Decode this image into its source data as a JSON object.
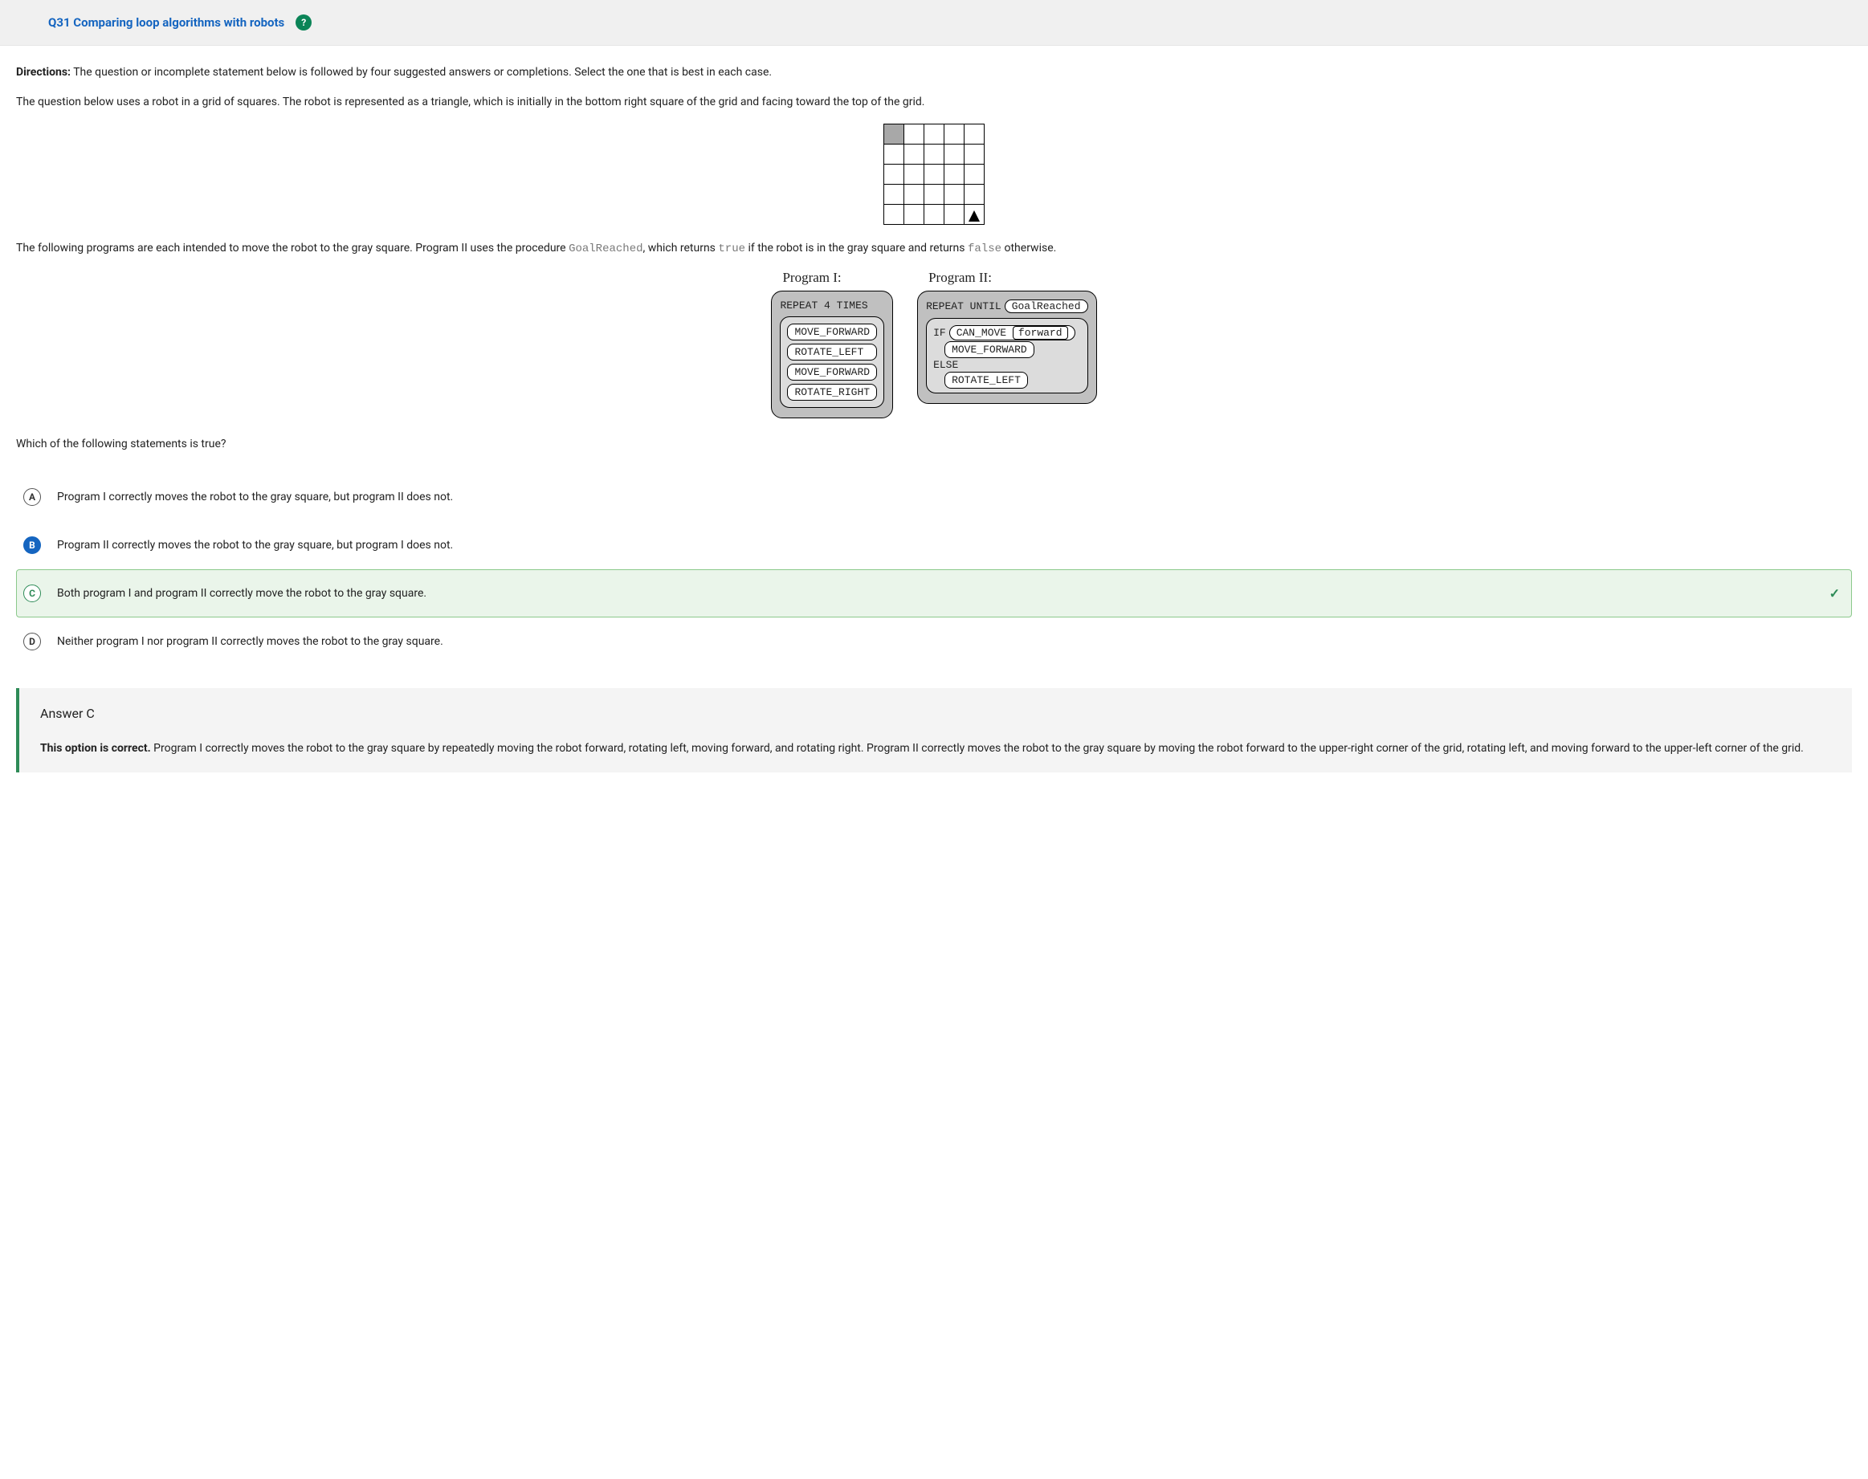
{
  "header": {
    "title": "Q31 Comparing loop algorithms with robots",
    "help_icon": "?"
  },
  "directions": {
    "label": "Directions:",
    "text": "The question or incomplete statement below is followed by four suggested answers or completions. Select the one that is best in each case."
  },
  "intro": "The question below uses a robot in a grid of squares. The robot is represented as a triangle, which is initially in the bottom right square of the grid and facing toward the top of the grid.",
  "grid": {
    "rows": 5,
    "cols": 5,
    "gray": [
      0,
      0
    ],
    "robot": [
      4,
      4
    ]
  },
  "para2": {
    "pre": "The following programs are each intended to move the robot to the gray square. Program II uses the procedure ",
    "code1": "GoalReached",
    "mid": ", which returns ",
    "code2": "true",
    "mid2": " if the robot is in the gray square and returns ",
    "code3": "false",
    "post": " otherwise."
  },
  "prog1": {
    "title": "Program I:",
    "repeat": "REPEAT 4 TIMES",
    "cmds": [
      "MOVE_FORWARD",
      "ROTATE_LEFT",
      "MOVE_FORWARD",
      "ROTATE_RIGHT"
    ]
  },
  "prog2": {
    "title": "Program II:",
    "repeat_pre": "REPEAT UNTIL",
    "repeat_cond": "GoalReached",
    "if_pre": "IF",
    "if_fn": "CAN_MOVE",
    "if_arg": "forward",
    "then_cmd": "MOVE_FORWARD",
    "else_label": "ELSE",
    "else_cmd": "ROTATE_LEFT"
  },
  "question": "Which of the following statements is true?",
  "choices": [
    {
      "letter": "A",
      "text": "Program I correctly moves the robot to the gray square, but program II does not.",
      "selected": false,
      "correct": false
    },
    {
      "letter": "B",
      "text": "Program II correctly moves the robot to the gray square, but program I does not.",
      "selected": true,
      "correct": false
    },
    {
      "letter": "C",
      "text": "Both program I and program II correctly move the robot to the gray square.",
      "selected": false,
      "correct": true
    },
    {
      "letter": "D",
      "text": "Neither program I nor program II correctly moves the robot to the gray square.",
      "selected": false,
      "correct": false
    }
  ],
  "explanation": {
    "title": "Answer C",
    "lead": "This option is correct.",
    "body": " Program I correctly moves the robot to the gray square by repeatedly moving the robot forward, rotating left, moving forward, and rotating right. Program II correctly moves the robot to the gray square by moving the robot forward to the upper-right corner of the grid, rotating left, and moving forward to the upper-left corner of the grid."
  }
}
